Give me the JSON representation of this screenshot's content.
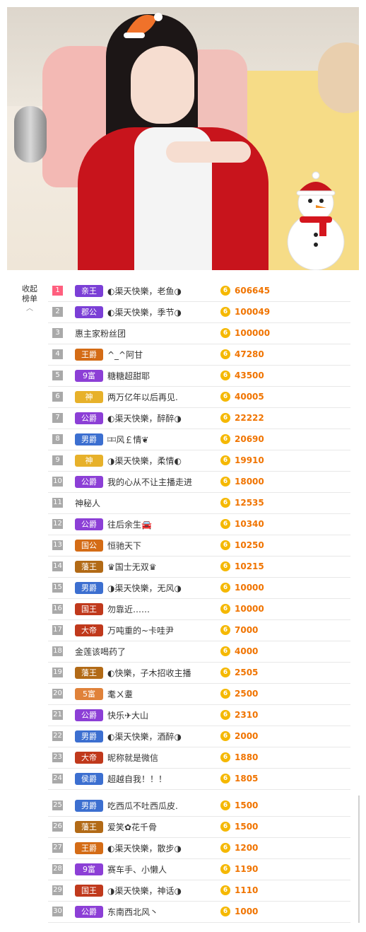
{
  "side": {
    "collapse_label": "收起榜单"
  },
  "colors": {
    "rank1": "#ff5f7e",
    "rank_default": "#a9a9a9",
    "amount": "#f07400",
    "coin": "#f5b800"
  },
  "rows": [
    {
      "rank": "1",
      "badge": "亲王",
      "badge_color": "#7b3fd6",
      "name": "◐渠天快樂，老鱼◑",
      "amount": "606645"
    },
    {
      "rank": "2",
      "badge": "郡公",
      "badge_color": "#7b3fd6",
      "name": "◐渠天快樂，季节◑",
      "amount": "100049"
    },
    {
      "rank": "3",
      "badge": "",
      "badge_color": "",
      "name": "惠主家粉丝团",
      "amount": "100000"
    },
    {
      "rank": "4",
      "badge": "王爵",
      "badge_color": "#d46c16",
      "name": "^_^阿甘",
      "amount": "47280"
    },
    {
      "rank": "5",
      "badge": "9富",
      "badge_color": "#8c3fd6",
      "name": "糖糖超甜耶",
      "amount": "43500"
    },
    {
      "rank": "6",
      "badge": "神",
      "badge_color": "#e7b12a",
      "name": "两万亿年以后再见.",
      "amount": "40005"
    },
    {
      "rank": "7",
      "badge": "公爵",
      "badge_color": "#8c3fd6",
      "name": "◐渠天快樂，醉醉◑",
      "amount": "22222"
    },
    {
      "rank": "8",
      "badge": "男爵",
      "badge_color": "#3c6fd0",
      "name": "⌑⌑风￡情❦",
      "amount": "20690"
    },
    {
      "rank": "9",
      "badge": "神",
      "badge_color": "#e7b12a",
      "name": "◑渠天快樂，柔情◐",
      "amount": "19910"
    },
    {
      "rank": "10",
      "badge": "公爵",
      "badge_color": "#8c3fd6",
      "name": "我的心从不让主播走进",
      "amount": "18000"
    },
    {
      "rank": "11",
      "badge": "",
      "badge_color": "",
      "name": "神秘人",
      "amount": "12535"
    },
    {
      "rank": "12",
      "badge": "公爵",
      "badge_color": "#8c3fd6",
      "name": "往后余生🚘",
      "amount": "10340"
    },
    {
      "rank": "13",
      "badge": "国公",
      "badge_color": "#d46c16",
      "name": "恒驰天下",
      "amount": "10250"
    },
    {
      "rank": "14",
      "badge": "藩王",
      "badge_color": "#b26a16",
      "name": "♛国士无双♛",
      "amount": "10215"
    },
    {
      "rank": "15",
      "badge": "男爵",
      "badge_color": "#3c6fd0",
      "name": "◑渠天快樂，无风◑",
      "amount": "10000"
    },
    {
      "rank": "16",
      "badge": "国王",
      "badge_color": "#c0391c",
      "name": "勿靠近……",
      "amount": "10000"
    },
    {
      "rank": "17",
      "badge": "大帝",
      "badge_color": "#c0391c",
      "name": "万吨重的~卡哇尹",
      "amount": "7000"
    },
    {
      "rank": "18",
      "badge": "",
      "badge_color": "",
      "name": "金莲该喝药了",
      "amount": "4000"
    },
    {
      "rank": "19",
      "badge": "藩王",
      "badge_color": "#b26a16",
      "name": "◐快樂，子木招收主播",
      "amount": "2505"
    },
    {
      "rank": "20",
      "badge": "5富",
      "badge_color": "#e0823a",
      "name": "耄ㄨ耋",
      "amount": "2500"
    },
    {
      "rank": "21",
      "badge": "公爵",
      "badge_color": "#8c3fd6",
      "name": "快乐✈大山",
      "amount": "2310"
    },
    {
      "rank": "22",
      "badge": "男爵",
      "badge_color": "#3c6fd0",
      "name": "◐渠天快樂，酒醉◑",
      "amount": "2000"
    },
    {
      "rank": "23",
      "badge": "大帝",
      "badge_color": "#c0391c",
      "name": "昵称就是微信",
      "amount": "1880"
    },
    {
      "rank": "24",
      "badge": "侯爵",
      "badge_color": "#3c6fd0",
      "name": "超越自我！！！",
      "amount": "1805"
    },
    {
      "rank": "25",
      "badge": "男爵",
      "badge_color": "#3c6fd0",
      "name": "吃西瓜不吐西瓜皮.",
      "amount": "1500"
    },
    {
      "rank": "26",
      "badge": "藩王",
      "badge_color": "#b26a16",
      "name": "爱笑✿花千骨",
      "amount": "1500"
    },
    {
      "rank": "27",
      "badge": "王爵",
      "badge_color": "#d46c16",
      "name": "◐渠天快樂，散步◑",
      "amount": "1200"
    },
    {
      "rank": "28",
      "badge": "9富",
      "badge_color": "#8c3fd6",
      "name": "赛车手、小懒人",
      "amount": "1190"
    },
    {
      "rank": "29",
      "badge": "国王",
      "badge_color": "#c0391c",
      "name": "◑渠天快樂，神话◑",
      "amount": "1110"
    },
    {
      "rank": "30",
      "badge": "公爵",
      "badge_color": "#8c3fd6",
      "name": "东南西北风丶",
      "amount": "1000"
    }
  ]
}
